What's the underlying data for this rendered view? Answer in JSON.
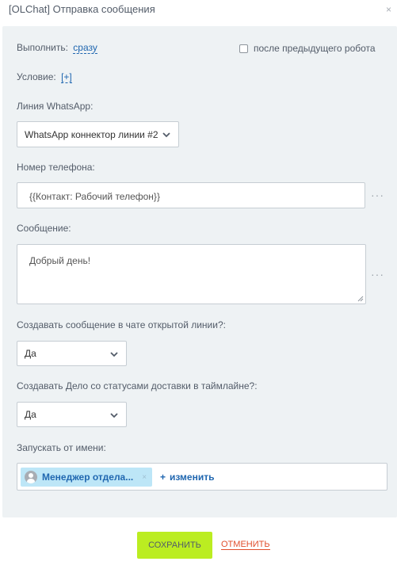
{
  "header": {
    "title": "[OLChat] Отправка сообщения",
    "close": "×"
  },
  "execute": {
    "label": "Выполнить:",
    "value": "сразу"
  },
  "after_robot": {
    "label": "после предыдущего робота",
    "checked": false
  },
  "condition": {
    "label": "Условие:",
    "value": "[+]"
  },
  "whatsapp_line": {
    "label": "Линия WhatsApp:",
    "selected": "WhatsApp коннектор линии #2"
  },
  "phone": {
    "label": "Номер телефона:",
    "value": "{{Контакт: Рабочий телефон}}"
  },
  "message": {
    "label": "Сообщение:",
    "value": "Добрый день!"
  },
  "create_in_chat": {
    "label": "Создавать сообщение в чате открытой линии?:",
    "selected": "Да"
  },
  "create_activity": {
    "label": "Создавать Дело со статусами доставки в таймлайне?:",
    "selected": "Да"
  },
  "run_as": {
    "label": "Запускать от имени:",
    "user": "Менеджер отдела...",
    "change": "изменить"
  },
  "footer": {
    "save": "СОХРАНИТЬ",
    "cancel": "ОТМЕНИТЬ"
  },
  "more_dots": "···",
  "icons": {
    "close": "close-icon",
    "chevron": "chevron-down-icon",
    "avatar": "user-avatar-icon",
    "more": "more-dots-icon"
  },
  "colors": {
    "panel": "#eef2f4",
    "link": "#2067b0",
    "save_button": "#bbed21",
    "cancel": "#e14e2c",
    "tag": "#bde6f7"
  }
}
